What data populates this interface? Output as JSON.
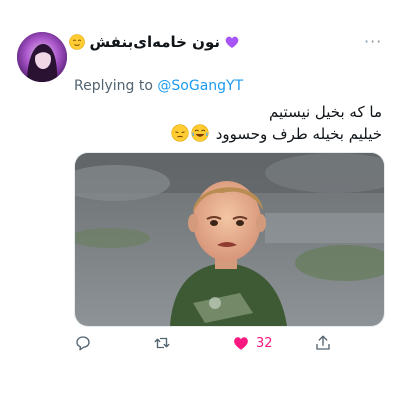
{
  "tweet": {
    "author_name": "نون خامه‌ای‌بنفش",
    "replying_prefix": "Replying to",
    "replying_handle": "@SoGangYT",
    "text_line1": "ما که بخیل نیستیم",
    "text_line2": "خیلیم بخیله طرف وحسوود",
    "like_count": "32"
  },
  "icons": {
    "more": "more-icon",
    "reply": "reply-icon",
    "retweet": "retweet-icon",
    "like": "heart-icon",
    "share": "share-icon"
  },
  "colors": {
    "accent": "#1d9bf0",
    "like": "#f91880",
    "secondary_text": "#536471",
    "icon_gray": "#536471"
  }
}
